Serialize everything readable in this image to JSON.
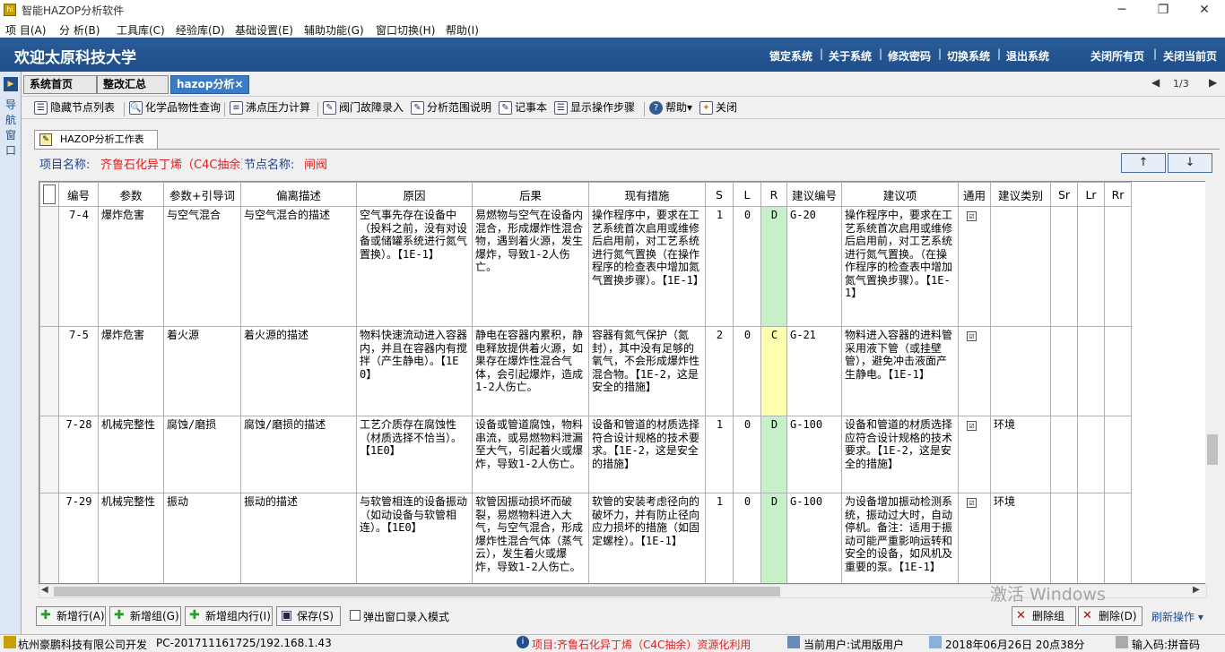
{
  "window": {
    "title": "智能HAZOP分析软件",
    "icon_text": "hi",
    "minimize": "─",
    "maximize": "❐",
    "close": "✕"
  },
  "menu": [
    "项 目(A)",
    "分 析(B)",
    "工具库(C)",
    "经验库(D)",
    "基础设置(E)",
    "辅助功能(G)",
    "窗口切换(H)",
    "帮助(I)"
  ],
  "header": {
    "welcome": "欢迎太原科技大学",
    "links": [
      "锁定系统",
      "关于系统",
      "修改密码",
      "切换系统",
      "退出系统",
      "关闭所有页",
      "关闭当前页"
    ],
    "sep": "|"
  },
  "leftnav": {
    "arrow": "▶",
    "chars": [
      "导",
      "航",
      "窗",
      "口"
    ]
  },
  "tabs": [
    "系统首页",
    "整改汇总",
    "hazop分析"
  ],
  "tab_close": "×",
  "pager": {
    "left": "◀",
    "text": "1/3",
    "right": "▶"
  },
  "toolbar": [
    {
      "label": "隐藏节点列表",
      "icon": "list-icon",
      "glyph": "☰"
    },
    {
      "label": "化学品物性查询",
      "icon": "magnifier-icon",
      "glyph": "🔍"
    },
    {
      "label": "沸点压力计算",
      "icon": "document-icon",
      "glyph": "≡"
    },
    {
      "label": "阀门故障录入",
      "icon": "edit-icon",
      "glyph": "✎"
    },
    {
      "label": "分析范围说明",
      "icon": "edit-icon",
      "glyph": "✎"
    },
    {
      "label": "记事本",
      "icon": "edit-icon",
      "glyph": "✎"
    },
    {
      "label": "显示操作步骤",
      "icon": "list-icon",
      "glyph": "☰"
    },
    {
      "label": "帮助▾",
      "icon": "help-icon",
      "glyph": "?"
    },
    {
      "label": "关闭",
      "icon": "close-icon",
      "glyph": "✦"
    }
  ],
  "worksheet_tab": "HAZOP分析工作表",
  "project": {
    "label": "项目名称:",
    "value": "齐鲁石化异丁烯（C4C抽余）资源化利用",
    "node_label": "节点名称:",
    "node_value": "闸阀"
  },
  "arrows": {
    "up": "↑",
    "down": "↓"
  },
  "table": {
    "headers": [
      "",
      "编号",
      "参数",
      "参数+引导词",
      "偏离描述",
      "原因",
      "后果",
      "现有措施",
      "S",
      "L",
      "R",
      "建议编号",
      "建议项",
      "通用",
      "建议类别",
      "Sr",
      "Lr",
      "Rr"
    ],
    "rows": [
      {
        "id": "7-4",
        "param": "爆炸危害",
        "guide": "与空气混合",
        "deviation": "与空气混合的描述",
        "cause": "空气事先存在设备中（投料之前，没有对设备或储罐系统进行氮气置换）。【1E-1】",
        "consequence": "易燃物与空气在设备内混合，形成爆炸性混合物，遇到着火源，发生爆炸，导致1-2人伤亡。",
        "measures": "操作程序中，要求在工艺系统首次启用或维修后启用前，对工艺系统进行氮气置换（在操作程序的检查表中增加氮气置换步骤）。【1E-1】",
        "s": "1",
        "l": "0",
        "r": "D",
        "sugg_no": "G-20",
        "suggestion": "操作程序中，要求在工艺系统首次启用或维修后启用前，对工艺系统进行氮气置换。（在操作程序的检查表中增加氮气置换步骤）。【1E-1】",
        "general": "☑",
        "category": "",
        "sr": "",
        "lr": "",
        "rr": ""
      },
      {
        "id": "7-5",
        "param": "爆炸危害",
        "guide": "着火源",
        "deviation": "着火源的描述",
        "cause": "物料快速流动进入容器内，并且在容器内有搅拌（产生静电）。【1E0】",
        "consequence": "静电在容器内累积，静电释放提供着火源，如果存在爆炸性混合气体，会引起爆炸，造成1-2人伤亡。",
        "measures": "容器有氮气保护（氮封），其中没有足够的氧气，不会形成爆炸性混合物。【1E-2，这是安全的措施】",
        "s": "2",
        "l": "0",
        "r": "C",
        "sugg_no": "G-21",
        "suggestion": "物料进入容器的进料管采用液下管（或挂壁管），避免冲击液面产生静电。【1E-1】",
        "general": "☑",
        "category": "",
        "sr": "",
        "lr": "",
        "rr": ""
      },
      {
        "id": "7-28",
        "param": "机械完整性",
        "guide": "腐蚀/磨损",
        "deviation": "腐蚀/磨损的描述",
        "cause": "工艺介质存在腐蚀性（材质选择不恰当）。【1E0】",
        "consequence": "设备或管道腐蚀，物料串流，或易燃物料泄漏至大气，引起着火或爆炸，导致1-2人伤亡。",
        "measures": "设备和管道的材质选择符合设计规格的技术要求。【1E-2，这是安全的措施】",
        "s": "1",
        "l": "0",
        "r": "D",
        "sugg_no": "G-100",
        "suggestion": "设备和管道的材质选择应符合设计规格的技术要求。【1E-2，这是安全的措施】",
        "general": "☑",
        "category": "环境",
        "sr": "",
        "lr": "",
        "rr": ""
      },
      {
        "id": "7-29",
        "param": "机械完整性",
        "guide": "振动",
        "deviation": "振动的描述",
        "cause": "与软管相连的设备振动（如动设备与软管相连）。【1E0】",
        "consequence": "软管因振动损坏而破裂，易燃物料进入大气，与空气混合，形成爆炸性混合气体（蒸气云），发生着火或爆炸，导致1-2人伤亡。",
        "measures": "软管的安装考虑径向的破坏力，并有防止径向应力损坏的措施（如固定螺栓）。【1E-1】",
        "s": "1",
        "l": "0",
        "r": "D",
        "sugg_no": "G-100",
        "suggestion": "为设备增加振动检测系统，振动过大时，自动停机。备注：适用于振动可能严重影响运转和安全的设备，如风机及重要的泵。【1E-1】",
        "general": "☑",
        "category": "环境",
        "sr": "",
        "lr": "",
        "rr": ""
      }
    ]
  },
  "scroll": {
    "left": "◀",
    "right": "▶"
  },
  "bottom_buttons": [
    "新增行(A)",
    "新增组(G)",
    "新增组内行(I)",
    "保存(S)"
  ],
  "popup_mode": "弹出窗口录入模式",
  "delete_buttons": [
    "删除组",
    "删除(D)"
  ],
  "watermark": "激活 Windows",
  "refresh": "刷新操作 ▾",
  "status": {
    "company": "杭州豪鹏科技有限公司开发",
    "pc": "PC-201711161725/192.168.1.43",
    "project": "项目:齐鲁石化异丁烯（C4C抽余）资源化利用",
    "user": "当前用户:试用版用户",
    "date": "2018年06月26日 20点38分",
    "ime": "输入码:拼音码"
  }
}
